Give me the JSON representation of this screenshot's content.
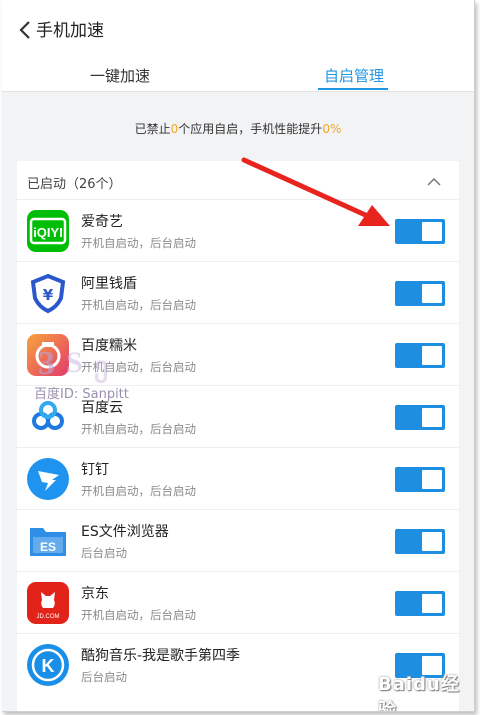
{
  "header": {
    "title": "手机加速"
  },
  "tabs": [
    {
      "label": "一键加速"
    },
    {
      "label": "自启管理"
    }
  ],
  "summary": {
    "prefix": "已禁止",
    "count": "0",
    "middle": "个应用自启，手机性能提升",
    "percent": "0%"
  },
  "section": {
    "title": "已启动（26个）"
  },
  "apps": [
    {
      "name": "爱奇艺",
      "desc": "开机自启动，后台启动",
      "icon": "iqiyi-icon",
      "color": "#00be06",
      "enabled": true
    },
    {
      "name": "阿里钱盾",
      "desc": "开机自启动，后台启动",
      "icon": "qiandun-shield-icon",
      "color": "#2a57c9",
      "enabled": true
    },
    {
      "name": "百度糯米",
      "desc": "开机自启动，后台启动",
      "icon": "nuomi-icon",
      "color": "#e4396f",
      "enabled": true
    },
    {
      "name": "百度云",
      "desc": "开机自启动，后台启动",
      "icon": "baidu-cloud-icon",
      "color": "#1e7ae0",
      "enabled": true
    },
    {
      "name": "钉钉",
      "desc": "开机自启动，后台启动",
      "icon": "dingtalk-icon",
      "color": "#1e94f0",
      "enabled": true
    },
    {
      "name": "ES文件浏览器",
      "desc": "后台启动",
      "icon": "es-folder-icon",
      "color": "#2f8fe6",
      "enabled": true
    },
    {
      "name": "京东",
      "desc": "开机自启动，后台启动",
      "icon": "jd-icon",
      "color": "#e2231a",
      "enabled": true
    },
    {
      "name": "酷狗音乐-我是歌手第四季",
      "desc": "后台启动",
      "icon": "kugou-icon",
      "color": "#1a8fe8",
      "enabled": true
    }
  ],
  "watermark": {
    "text": "百度ID: Sanpitt",
    "logo": "Baidu经验"
  },
  "colors": {
    "accent": "#2196e3",
    "toggle_on": "#1e8fe0",
    "highlight": "#f5a623",
    "annotation": "#e8241f"
  }
}
